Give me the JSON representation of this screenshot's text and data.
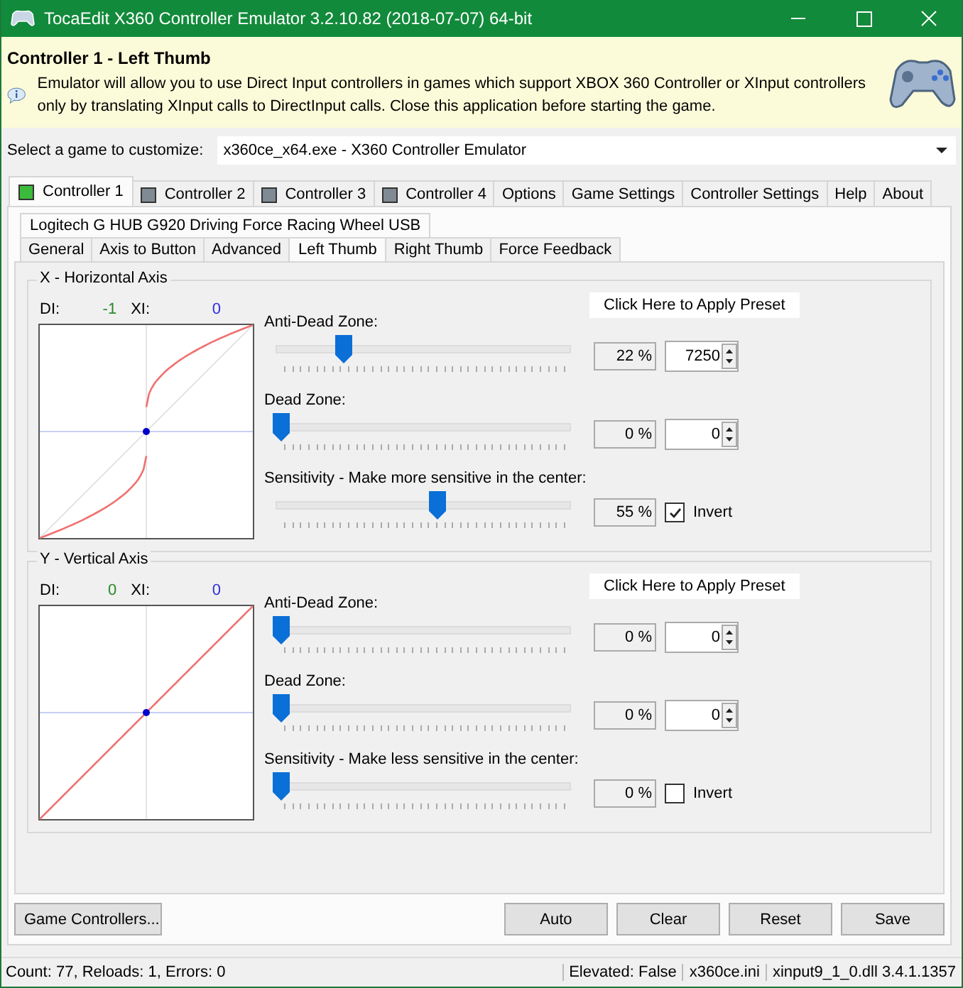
{
  "window": {
    "title": "TocaEdit X360 Controller Emulator 3.2.10.82 (2018-07-07) 64-bit"
  },
  "header": {
    "title": "Controller 1 - Left Thumb",
    "message": "Emulator will allow you to use Direct Input controllers in games which support XBOX 360 Controller or XInput controllers only by translating XInput calls to DirectInput calls. Close this application before starting the game."
  },
  "game_select": {
    "label": "Select a game to customize:",
    "value": "x360ce_x64.exe - X360 Controller Emulator"
  },
  "main_tabs": [
    {
      "label": "Controller 1",
      "selected": true,
      "color": "#3cba3c"
    },
    {
      "label": "Controller 2",
      "selected": false,
      "color": "#7f8a94"
    },
    {
      "label": "Controller 3",
      "selected": false,
      "color": "#7f8a94"
    },
    {
      "label": "Controller 4",
      "selected": false,
      "color": "#7f8a94"
    },
    {
      "label": "Options",
      "selected": false
    },
    {
      "label": "Game Settings",
      "selected": false
    },
    {
      "label": "Controller Settings",
      "selected": false
    },
    {
      "label": "Help",
      "selected": false
    },
    {
      "label": "About",
      "selected": false
    }
  ],
  "device_tab": {
    "label": "Logitech G HUB G920 Driving Force Racing Wheel USB"
  },
  "sub_tabs": [
    {
      "label": "General",
      "selected": false
    },
    {
      "label": "Axis to Button",
      "selected": false
    },
    {
      "label": "Advanced",
      "selected": false
    },
    {
      "label": "Left Thumb",
      "selected": true
    },
    {
      "label": "Right Thumb",
      "selected": false
    },
    {
      "label": "Force Feedback",
      "selected": false
    }
  ],
  "axes": [
    {
      "title": "X - Horizontal Axis",
      "di_label": "DI:",
      "di_value": "-1",
      "xi_label": "XI:",
      "xi_value": "0",
      "preset_button": "Click Here to Apply Preset",
      "sliders": [
        {
          "label": "Anti-Dead Zone:",
          "level": 0.22,
          "percent": "22 %",
          "value": "7250"
        },
        {
          "label": "Dead Zone:",
          "level": 0,
          "percent": "0 %",
          "value": "0"
        },
        {
          "label": "Sensitivity - Make more sensitive in the center:",
          "level": 0.55,
          "percent": "55 %",
          "invert": {
            "label": "Invert",
            "checked": true
          }
        }
      ]
    },
    {
      "title": "Y - Vertical Axis",
      "di_label": "DI:",
      "di_value": "0",
      "xi_label": "XI:",
      "xi_value": "0",
      "preset_button": "Click Here to Apply Preset",
      "sliders": [
        {
          "label": "Anti-Dead Zone:",
          "level": 0,
          "percent": "0 %",
          "value": "0"
        },
        {
          "label": "Dead Zone:",
          "level": 0,
          "percent": "0 %",
          "value": "0"
        },
        {
          "label": "Sensitivity - Make less sensitive in the center:",
          "level": 0,
          "percent": "0 %",
          "invert": {
            "label": "Invert",
            "checked": false
          }
        }
      ]
    }
  ],
  "left_button": "Game Controllers...",
  "buttons": [
    "Auto",
    "Clear",
    "Reset",
    "Save"
  ],
  "status_bar": {
    "left": "Count: 77, Reloads: 1, Errors: 0",
    "sections": [
      "Elevated: False",
      "x360ce.ini",
      "xinput9_1_0.dll 3.4.1.1357"
    ]
  }
}
